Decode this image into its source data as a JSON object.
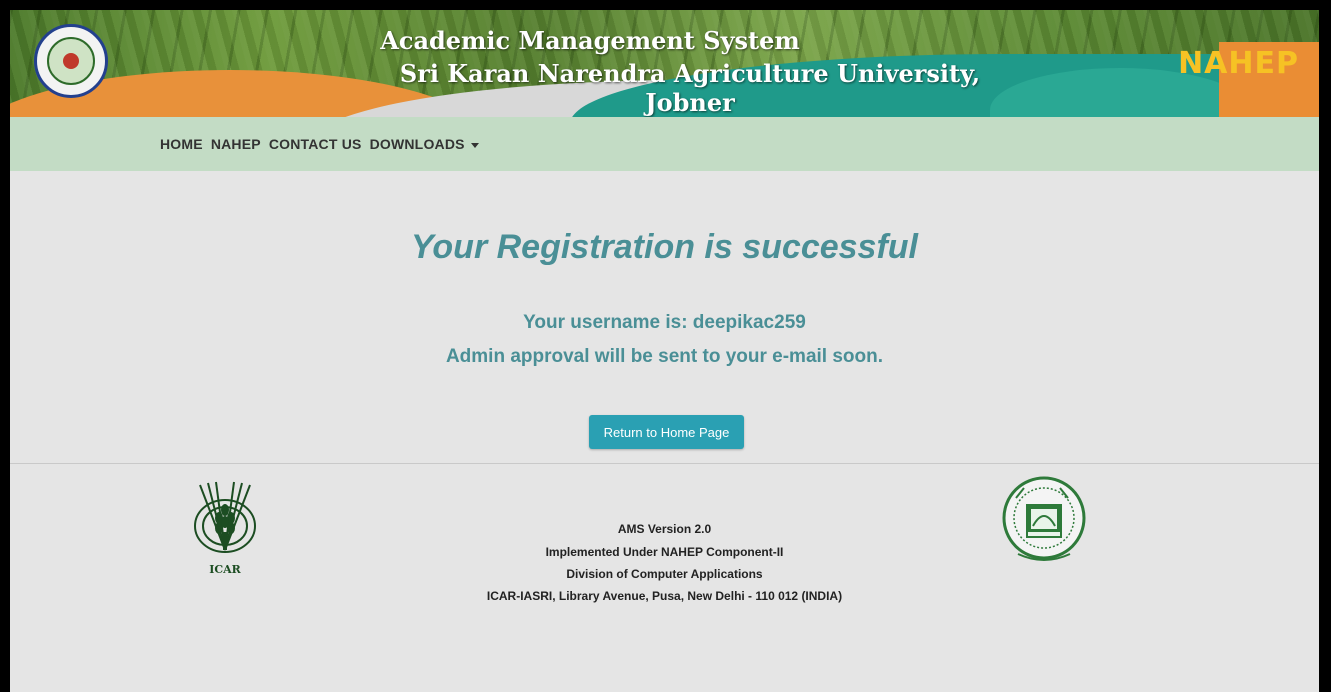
{
  "header": {
    "title": "Academic Management System",
    "subtitle": "Sri Karan Narendra Agriculture University, Jobner",
    "partner_logo_text": "NAHEP"
  },
  "nav": {
    "items": [
      "HOME",
      "NAHEP",
      "CONTACT US",
      "DOWNLOADS"
    ]
  },
  "main": {
    "heading": "Your Registration is successful",
    "username_line": "Your username is: deepikac259",
    "approval_line": "Admin approval will be sent to your e-mail soon.",
    "return_button": "Return to Home Page"
  },
  "footer": {
    "icar_logo_text": "ICAR",
    "version": "AMS Version 2.0",
    "implemented": "Implemented Under NAHEP Component-II",
    "division": "Division of Computer Applications",
    "address": "ICAR-IASRI, Library Avenue, Pusa, New Delhi - 110 012 (INDIA)"
  },
  "colors": {
    "accent_text": "#4a8f96",
    "nav_bg": "#c3dcc5",
    "button_bg": "#2aa0b3"
  }
}
